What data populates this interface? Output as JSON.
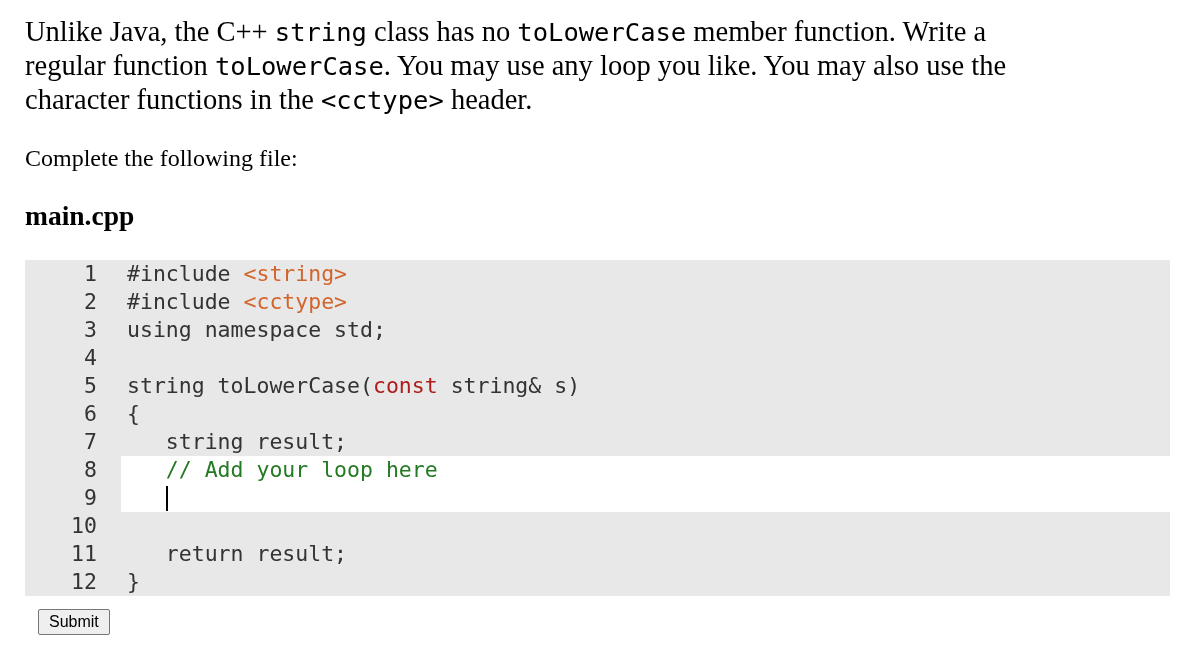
{
  "intro": [
    {
      "kind": "text",
      "text": "Unlike Java, the C++ "
    },
    {
      "kind": "code",
      "text": "string"
    },
    {
      "kind": "text",
      "text": " class has no "
    },
    {
      "kind": "code",
      "text": "toLowerCase"
    },
    {
      "kind": "text",
      "text": " member function. Write a regular function "
    },
    {
      "kind": "code",
      "text": "toLowerCase"
    },
    {
      "kind": "text",
      "text": ". You may use any loop you like. You may also use the character functions in the "
    },
    {
      "kind": "code",
      "text": "<cctype>"
    },
    {
      "kind": "text",
      "text": " header."
    }
  ],
  "instruction": "Complete the following file:",
  "file_name": "main.cpp",
  "code_lines": [
    {
      "number": "1",
      "editable": false,
      "cursor": false,
      "tokens": [
        {
          "kind": "plain",
          "text": "#include "
        },
        {
          "kind": "header",
          "text": "<string>"
        }
      ]
    },
    {
      "number": "2",
      "editable": false,
      "cursor": false,
      "tokens": [
        {
          "kind": "plain",
          "text": "#include "
        },
        {
          "kind": "header",
          "text": "<cctype>"
        }
      ]
    },
    {
      "number": "3",
      "editable": false,
      "cursor": false,
      "tokens": [
        {
          "kind": "plain",
          "text": "using namespace std;"
        }
      ]
    },
    {
      "number": "4",
      "editable": false,
      "cursor": false
    },
    {
      "number": "5",
      "editable": false,
      "cursor": false,
      "tokens": [
        {
          "kind": "plain",
          "text": "string toLowerCase("
        },
        {
          "kind": "keyword",
          "text": "const"
        },
        {
          "kind": "plain",
          "text": " string& s)"
        }
      ]
    },
    {
      "number": "6",
      "editable": false,
      "cursor": false,
      "tokens": [
        {
          "kind": "plain",
          "text": "{"
        }
      ]
    },
    {
      "number": "7",
      "editable": false,
      "cursor": false,
      "tokens": [
        {
          "kind": "plain",
          "text": "   string result;"
        }
      ]
    },
    {
      "number": "8",
      "editable": true,
      "cursor": false,
      "tokens": [
        {
          "kind": "comment",
          "text": "   // Add your loop here"
        }
      ]
    },
    {
      "number": "9",
      "editable": true,
      "cursor": true
    },
    {
      "number": "10",
      "editable": false,
      "cursor": false
    },
    {
      "number": "11",
      "editable": false,
      "cursor": false,
      "tokens": [
        {
          "kind": "plain",
          "text": "   return result;"
        }
      ]
    },
    {
      "number": "12",
      "editable": false,
      "cursor": false,
      "tokens": [
        {
          "kind": "plain",
          "text": "}"
        }
      ]
    }
  ],
  "submit_button": {
    "label": "Submit"
  }
}
